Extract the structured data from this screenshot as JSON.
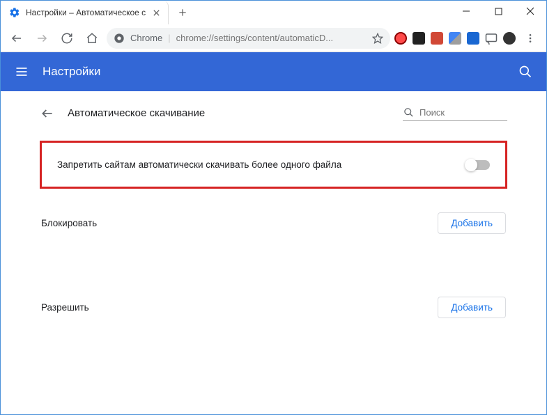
{
  "window": {
    "tab_title": "Настройки – Автоматическое с"
  },
  "toolbar": {
    "chrome_label": "Chrome",
    "url": "chrome://settings/content/automaticD..."
  },
  "header": {
    "title": "Настройки"
  },
  "page": {
    "title": "Автоматическое скачивание",
    "search_placeholder": "Поиск",
    "toggle_label": "Запретить сайтам автоматически скачивать более одного файла",
    "toggle_on": false,
    "block_section": "Блокировать",
    "allow_section": "Разрешить",
    "add_button": "Добавить"
  },
  "colors": {
    "header_bg": "#3367d6",
    "highlight_border": "#d62323",
    "link": "#1a73e8"
  }
}
